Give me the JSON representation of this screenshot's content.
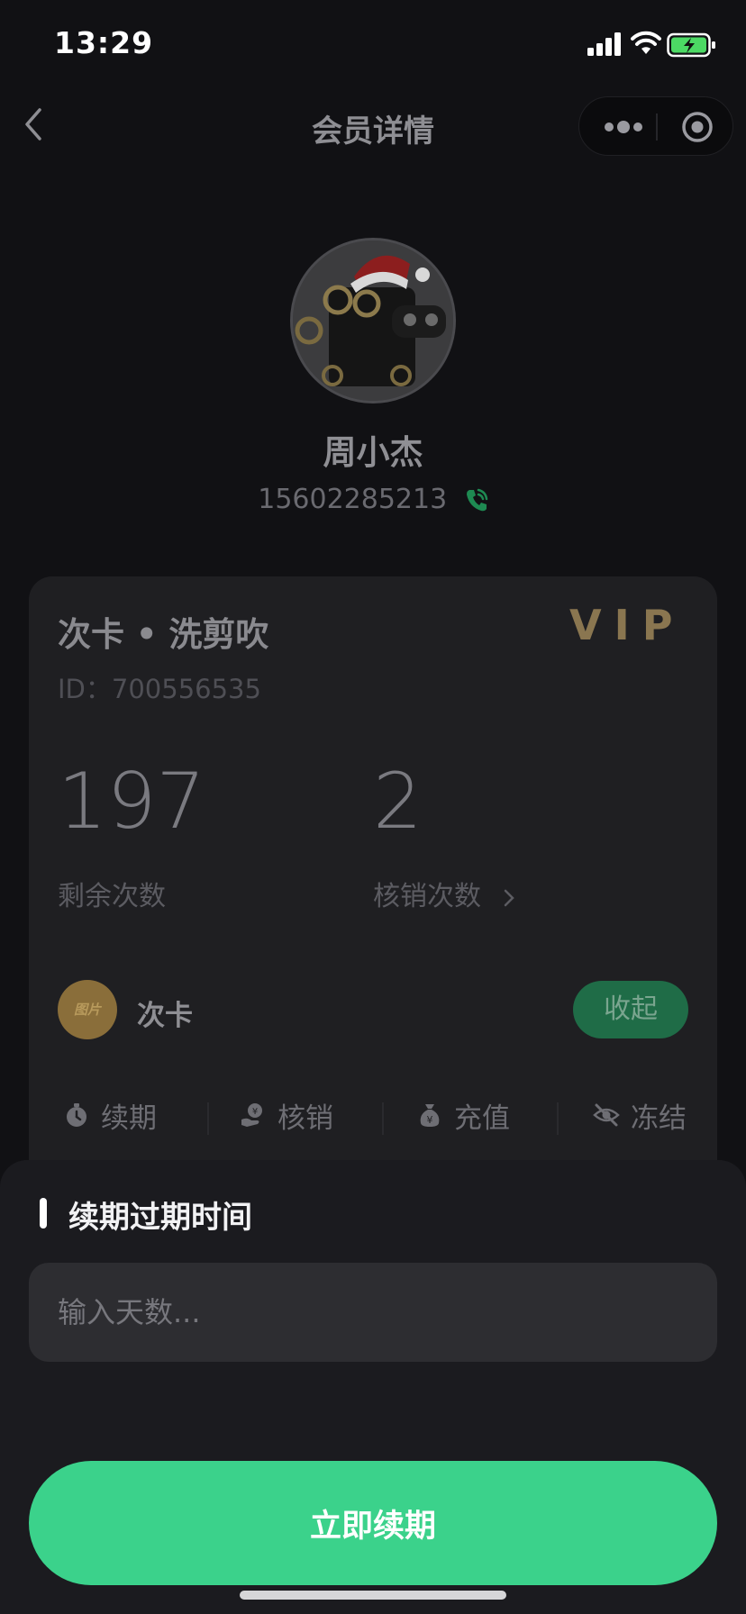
{
  "status_bar": {
    "time": "13:29"
  },
  "nav": {
    "title": "会员详情"
  },
  "profile": {
    "name": "周小杰",
    "phone": "15602285213"
  },
  "card": {
    "title": "次卡 • 洗剪吹",
    "id_label": "ID：",
    "id_value": "700556535",
    "badge": "VIP",
    "remaining_count": "197",
    "remaining_label": "剩余次数",
    "verified_count": "2",
    "verified_label": "核销次数",
    "type_icon_text": "图片",
    "type_label": "次卡",
    "collapse_label": "收起",
    "actions": [
      {
        "label": "续期",
        "icon": "stopwatch-icon"
      },
      {
        "label": "核销",
        "icon": "hand-coin-icon"
      },
      {
        "label": "充值",
        "icon": "money-bag-icon"
      },
      {
        "label": "冻结",
        "icon": "eye-off-icon"
      }
    ]
  },
  "sheet": {
    "title": "续期过期时间",
    "input_placeholder": "输入天数...",
    "submit_label": "立即续期"
  },
  "colors": {
    "accent_green": "#3bd28b",
    "collapse_green": "#1f6c47",
    "vip_gold": "#8a7650",
    "background": "#111114",
    "sheet": "#1b1b1f"
  }
}
